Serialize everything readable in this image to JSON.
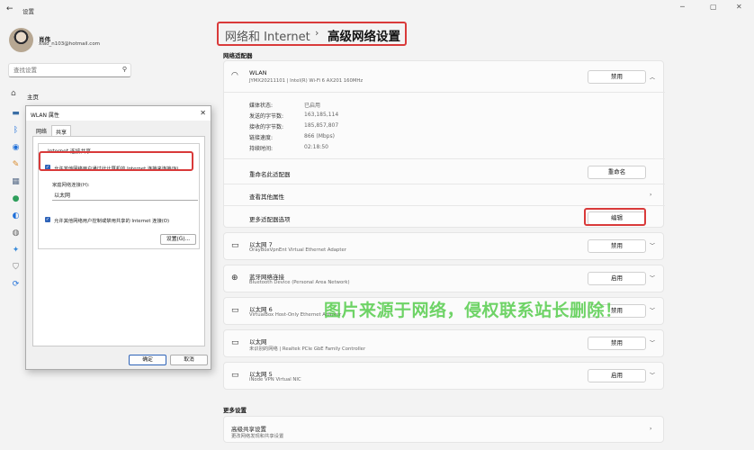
{
  "app": {
    "title": "设置"
  },
  "window": {
    "minimize": "─",
    "maximize": "▢",
    "close": "✕"
  },
  "user": {
    "name": "肖伟",
    "email": "xiao_n103@hotmail.com"
  },
  "search": {
    "placeholder": "查找设置"
  },
  "sidebar": {
    "home_label": "主页"
  },
  "breadcrumb": {
    "parent": "网络和 Internet",
    "separator": "›",
    "current": "高级网络设置"
  },
  "section": {
    "adapters_title": "网络适配器",
    "more_title": "更多设置"
  },
  "wlan": {
    "name": "WLAN",
    "description": "JYMX20211101 | Intel(R) Wi-Fi 6 AX201 160MHz",
    "button": "禁用",
    "stats": [
      {
        "label": "媒体状态:",
        "value": "已启用"
      },
      {
        "label": "发送的字节数:",
        "value": "163,185,114"
      },
      {
        "label": "接收的字节数:",
        "value": "185,857,807"
      },
      {
        "label": "链接速度:",
        "value": "866 (Mbps)"
      },
      {
        "label": "持续时间:",
        "value": "02:18:50"
      }
    ],
    "rename_label": "重命名此适配器",
    "rename_button": "重命名",
    "view_props_label": "查看其他属性",
    "more_options_label": "更多适配器选项",
    "edit_button": "编辑"
  },
  "adapters": [
    {
      "name": "以太网 7",
      "description": "OrayBoxVpnEnt Virtual Ethernet Adapter",
      "button": "禁用"
    },
    {
      "name": "蓝牙网络连接",
      "description": "Bluetooth Device (Personal Area Network)",
      "button": "启用"
    },
    {
      "name": "以太网 6",
      "description": "VirtualBox Host-Only Ethernet Adapter",
      "button": "禁用"
    },
    {
      "name": "以太网",
      "description": "未识别的网络 | Realtek PCIe GbE Family Controller",
      "button": "禁用"
    },
    {
      "name": "以太网 5",
      "description": "iNode VPN Virtual NIC",
      "button": "启用"
    }
  ],
  "advanced_sharing": {
    "title": "高级共享设置",
    "description": "更改网络发现和共享设置"
  },
  "dialog": {
    "title": "WLAN 属性",
    "tabs": [
      "网络",
      "共享"
    ],
    "group_title": "Internet 连接共享",
    "allow_share_label": "允许其他网络用户通过此计算机的 Internet 连接来连接(N)",
    "home_conn_label": "家庭网络连接(H):",
    "home_conn_value": "以太网",
    "allow_control_label": "允许其他网络用户控制或禁用共享的 Internet 连接(O)",
    "settings_button": "设置(G)...",
    "ok_button": "确定",
    "cancel_button": "取消"
  },
  "watermark": "图片来源于网络，侵权联系站长删除！",
  "colors": {
    "highlight": "#d93a3a",
    "accent": "#2e63b8",
    "watermark": "#46c83c"
  },
  "icons": {
    "wlan": "wifi-icon",
    "ethernet": "ethernet-icon",
    "bluetooth": "bluetooth-network-icon"
  }
}
